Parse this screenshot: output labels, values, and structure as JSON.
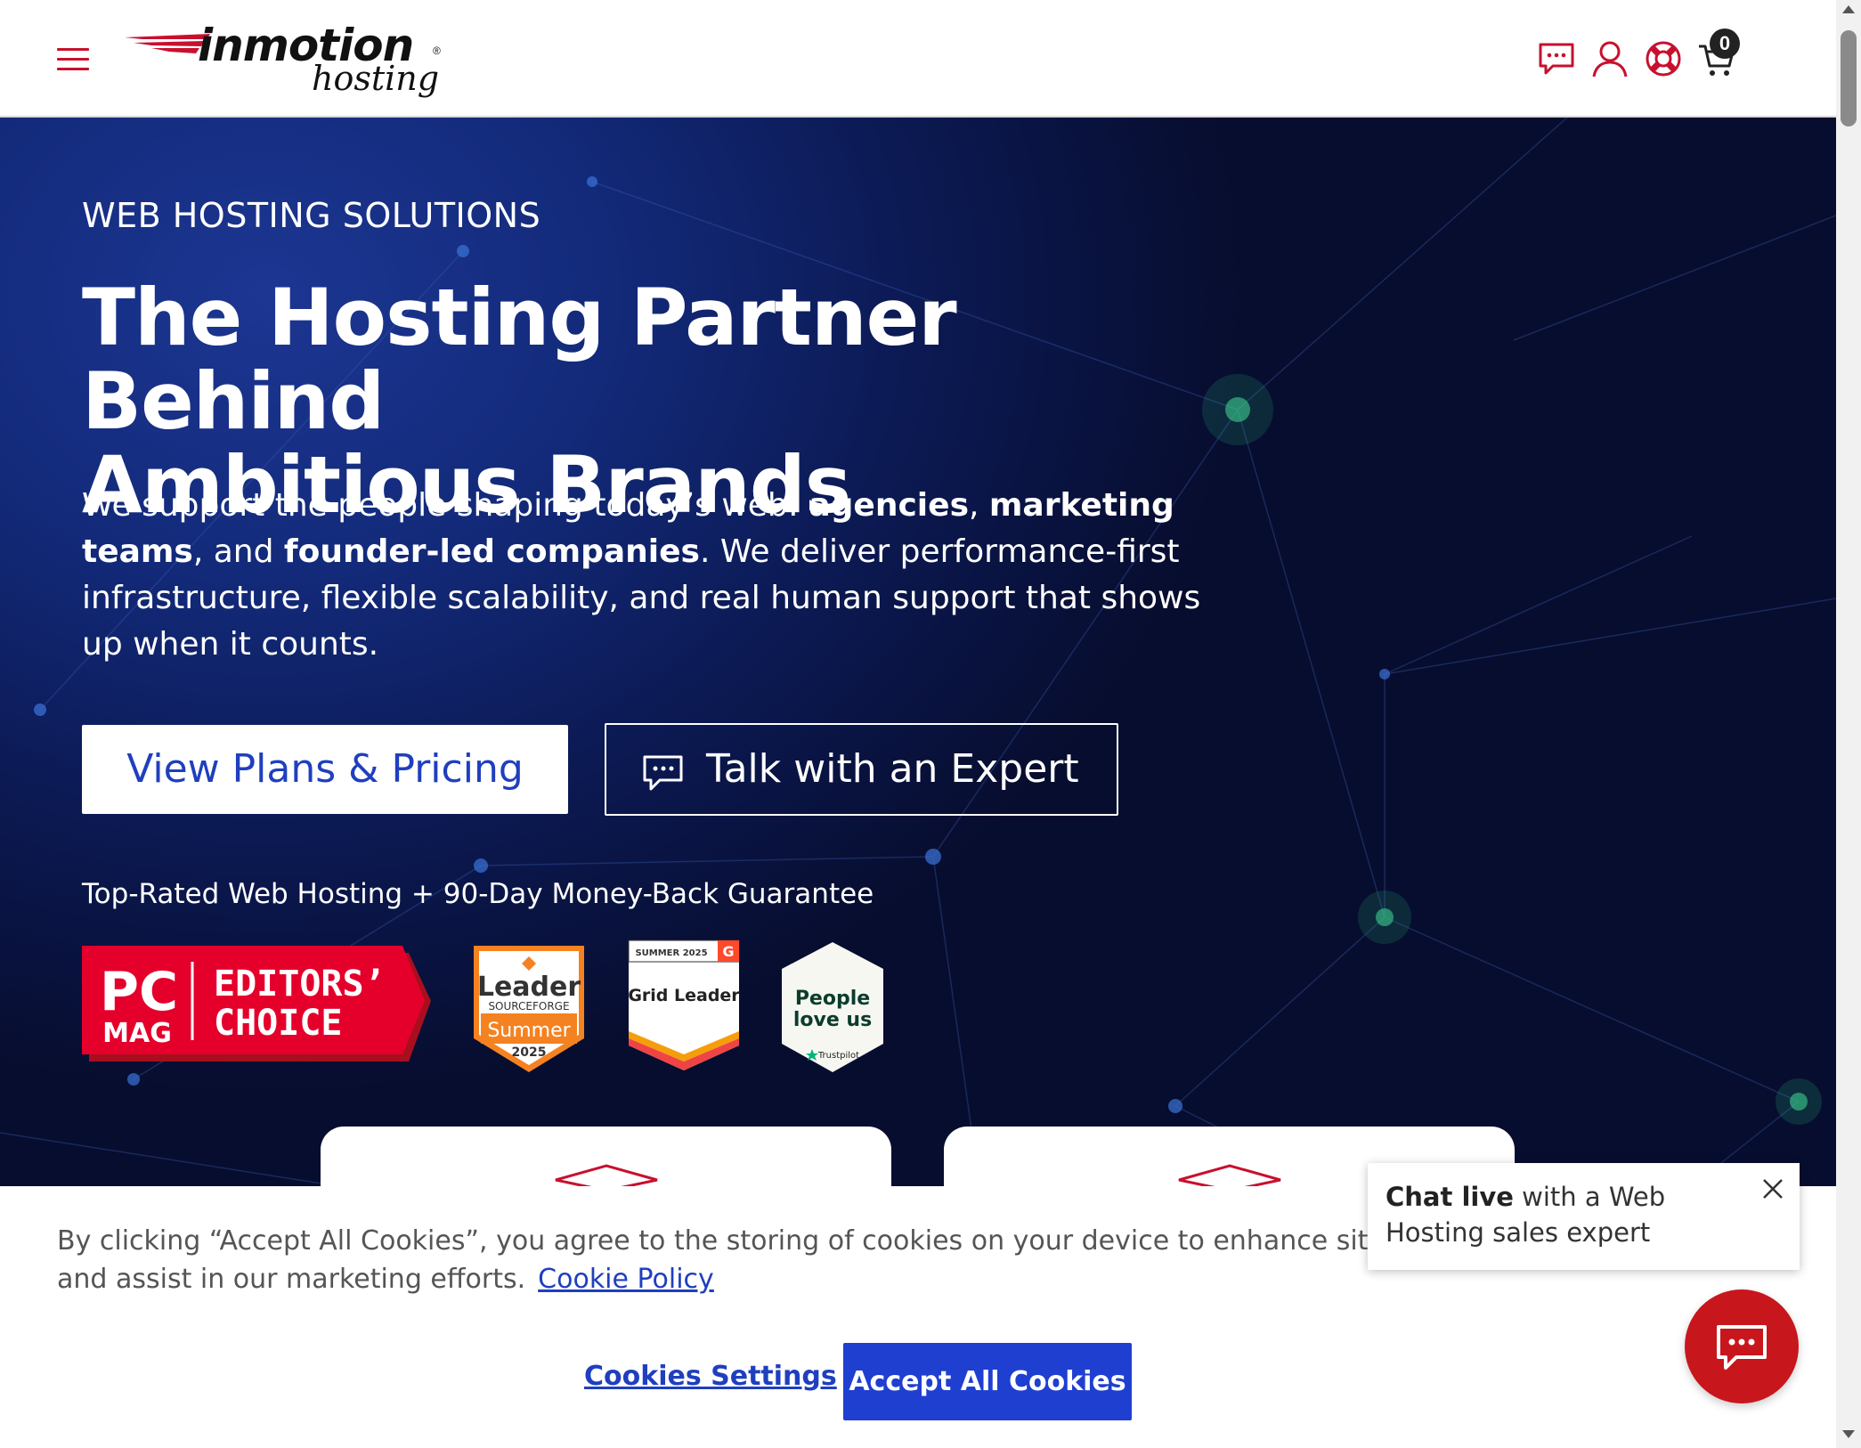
{
  "header": {
    "logo_main": "inmotion",
    "logo_sub": "hosting",
    "logo_reg": "®",
    "cart_count": "0",
    "icons": [
      "menu-icon",
      "chat-icon",
      "account-icon",
      "support-icon",
      "cart-icon"
    ],
    "accent_color": "#c8102e"
  },
  "hero": {
    "eyebrow": "WEB HOSTING SOLUTIONS",
    "headline_line1": "The Hosting Partner Behind",
    "headline_line2": "Ambitious Brands",
    "lede_prefix": "We support the people shaping today’s web: ",
    "lede_b1": "agencies",
    "lede_sep1": ", ",
    "lede_b2": "marketing teams",
    "lede_sep2": ", and ",
    "lede_b3": "founder-led companies",
    "lede_suffix": ". We deliver performance-first infrastructure, flexible scalability, and real human support that shows up when it counts.",
    "primary_button": "View Plans & Pricing",
    "secondary_button": "Talk with an Expert",
    "guarantee": "Top-Rated Web Hosting + 90-Day Money-Back Guarantee"
  },
  "badges": {
    "pcmag_pc": "PC",
    "pcmag_mag": "MAG",
    "pcmag_line1": "EDITORS’",
    "pcmag_line2": "CHOICE",
    "sf_leader": "Leader",
    "sf_brand": "SOURCEFORGE",
    "sf_season": "Summer",
    "sf_year": "2025",
    "g2_season": "SUMMER 2025",
    "g2_title": "Grid Leader",
    "tp_line1": "People",
    "tp_line2": "love us",
    "tp_brand": "Trustpilot"
  },
  "cookie": {
    "text_line1": "By clicking “Accept All Cookies”, you agree to the storing of cookies on your device to enhance site navi",
    "text_line2": "and assist in our marketing efforts.",
    "policy_link": "Cookie Policy",
    "settings_button": "Cookies Settings",
    "accept_button": "Accept All Cookies"
  },
  "chat": {
    "bold": "Chat live",
    "rest": " with a Web Hosting sales expert"
  }
}
